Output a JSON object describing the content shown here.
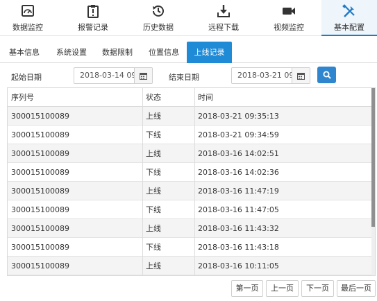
{
  "topnav": {
    "items": [
      {
        "label": "数据监控",
        "icon": "gauge-monitor-icon"
      },
      {
        "label": "报警记录",
        "icon": "alarm-log-icon"
      },
      {
        "label": "历史数据",
        "icon": "history-clock-icon"
      },
      {
        "label": "远程下载",
        "icon": "download-tray-icon"
      },
      {
        "label": "视频监控",
        "icon": "video-camera-icon"
      },
      {
        "label": "基本配置",
        "icon": "tools-icon"
      }
    ],
    "active_index": 5,
    "accent_color": "#1f7ac7"
  },
  "subtabs": {
    "items": [
      "基本信息",
      "系统设置",
      "数据限制",
      "位置信息",
      "上线记录"
    ],
    "active_index": 4,
    "active_color": "#1f8ad6"
  },
  "filter": {
    "start_label": "起始日期",
    "start_value": "2018-03-14 09",
    "end_label": "结束日期",
    "end_value": "2018-03-21 09",
    "calendar_icon": "calendar-icon",
    "search_icon": "search-icon",
    "search_color": "#2f86cf"
  },
  "table": {
    "headers": [
      "序列号",
      "状态",
      "时间"
    ],
    "rows": [
      {
        "serial": "300015100089",
        "status": "上线",
        "time": "2018-03-21 09:35:13"
      },
      {
        "serial": "300015100089",
        "status": "下线",
        "time": "2018-03-21 09:34:59"
      },
      {
        "serial": "300015100089",
        "status": "上线",
        "time": "2018-03-16 14:02:51"
      },
      {
        "serial": "300015100089",
        "status": "下线",
        "time": "2018-03-16 14:02:36"
      },
      {
        "serial": "300015100089",
        "status": "上线",
        "time": "2018-03-16 11:47:19"
      },
      {
        "serial": "300015100089",
        "status": "下线",
        "time": "2018-03-16 11:47:05"
      },
      {
        "serial": "300015100089",
        "status": "上线",
        "time": "2018-03-16 11:43:32"
      },
      {
        "serial": "300015100089",
        "status": "下线",
        "time": "2018-03-16 11:43:18"
      },
      {
        "serial": "300015100089",
        "status": "上线",
        "time": "2018-03-16 10:11:05"
      }
    ]
  },
  "pager": {
    "first": "第一页",
    "prev": "上一页",
    "next": "下一页",
    "last": "最后一页"
  }
}
